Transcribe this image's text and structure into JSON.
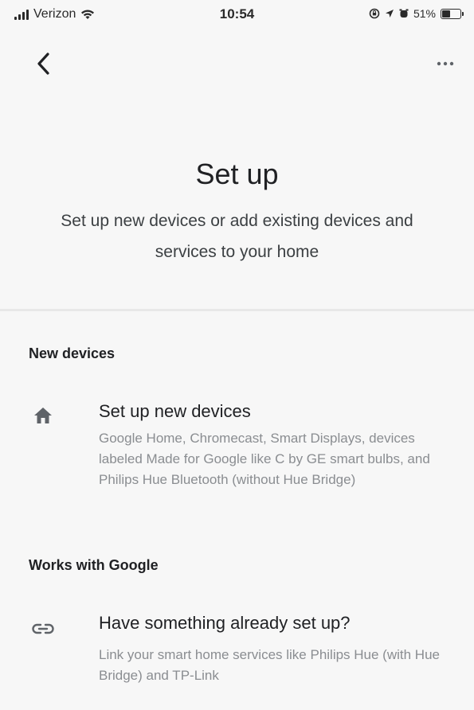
{
  "status_bar": {
    "carrier": "Verizon",
    "time": "10:54",
    "battery": "51%",
    "battery_level": 0.51
  },
  "nav": {
    "back_icon": "chevron-left-icon",
    "more_icon": "more-horizontal-icon"
  },
  "header": {
    "title": "Set up",
    "subtitle": "Set up new devices or add existing devices and services to your home"
  },
  "sections": [
    {
      "header": "New devices",
      "item": {
        "icon": "home-icon",
        "title": "Set up new devices",
        "description": "Google Home, Chromecast, Smart Displays, devices labeled Made for Google like C by GE smart bulbs, and Philips Hue Bluetooth (without Hue Bridge)"
      }
    },
    {
      "header": "Works with Google",
      "item": {
        "icon": "link-icon",
        "title": "Have something already set up?",
        "description": "Link your smart home services like Philips Hue (with Hue Bridge) and TP-Link"
      }
    }
  ],
  "colors": {
    "background": "#f7f7f7",
    "primary_text": "#202124",
    "secondary_text": "#8a8d91",
    "icon": "#5f6368"
  }
}
